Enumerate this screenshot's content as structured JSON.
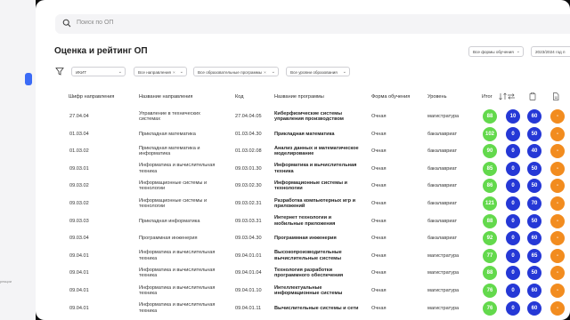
{
  "search": {
    "placeholder": "Поиск по ОП"
  },
  "page": {
    "title": "Оценка и рейтинг ОП"
  },
  "top_filters": {
    "forms": "Все формы обучения",
    "year": "2023/2024 год п"
  },
  "filters": {
    "institute": "ИКИТ",
    "directions": "Все направления",
    "programs": "Все образовательные программы",
    "levels": "Все уровни образования"
  },
  "sidebar": {
    "footer_text": "рекции"
  },
  "columns": {
    "code_dir": "Шифр направления",
    "name_dir": "Название направления",
    "code": "Код",
    "program": "Название программы",
    "form": "Форма обучения",
    "level": "Уровень",
    "total": "Итог"
  },
  "colors": {
    "green": "#63d94c",
    "blue": "#2538d6",
    "orange": "#f28c1f",
    "accent": "#3b6bf6"
  },
  "rows": [
    {
      "code_dir": "27.04.04",
      "name_dir": [
        "Управление в технических",
        "системах"
      ],
      "code": "27.04.04.05",
      "program": [
        "Киберфизические системы",
        "управления производством"
      ],
      "form": "Очная",
      "level": "магистратура",
      "total": "88",
      "s1": "10",
      "s2": "60",
      "s3": "-"
    },
    {
      "code_dir": "01.03.04",
      "name_dir": [
        "Прикладная математика"
      ],
      "code": "01.03.04.30",
      "program": [
        "Прикладная математика"
      ],
      "form": "Очная",
      "level": "бакалавриат",
      "total": "102",
      "s1": "0",
      "s2": "50",
      "s3": "-"
    },
    {
      "code_dir": "01.03.02",
      "name_dir": [
        "Прикладная математика и",
        "информатика"
      ],
      "code": "01.03.02.08",
      "program": [
        "Анализ данных и математическое",
        "моделирование"
      ],
      "form": "Очная",
      "level": "бакалавриат",
      "total": "90",
      "s1": "0",
      "s2": "40",
      "s3": "-"
    },
    {
      "code_dir": "09.03.01",
      "name_dir": [
        "Информатика и вычислительная",
        "техника"
      ],
      "code": "09.03.01.30",
      "program": [
        "Информатика и вычислительная",
        "техника"
      ],
      "form": "Очная",
      "level": "бакалавриат",
      "total": "85",
      "s1": "0",
      "s2": "50",
      "s3": "-"
    },
    {
      "code_dir": "09.03.02",
      "name_dir": [
        "Информационные системы и",
        "технологии"
      ],
      "code": "09.03.02.30",
      "program": [
        "Информационные системы и",
        "технологии"
      ],
      "form": "Очная",
      "level": "бакалавриат",
      "total": "86",
      "s1": "0",
      "s2": "50",
      "s3": "-"
    },
    {
      "code_dir": "09.03.02",
      "name_dir": [
        "Информационные системы и",
        "технологии"
      ],
      "code": "09.03.02.31",
      "program": [
        "Разработка компьютерных игр и",
        "приложений"
      ],
      "form": "Очная",
      "level": "бакалавриат",
      "total": "121",
      "s1": "0",
      "s2": "70",
      "s3": "-"
    },
    {
      "code_dir": "09.03.03",
      "name_dir": [
        "Прикладная информатика"
      ],
      "code": "09.03.03.31",
      "program": [
        "Интернет технологии и",
        "мобильные приложения"
      ],
      "form": "Очная",
      "level": "бакалавриат",
      "total": "88",
      "s1": "0",
      "s2": "50",
      "s3": "-"
    },
    {
      "code_dir": "09.03.04",
      "name_dir": [
        "Программная инженерия"
      ],
      "code": "09.03.04.30",
      "program": [
        "Программная инженерия"
      ],
      "form": "Очная",
      "level": "бакалавриат",
      "total": "92",
      "s1": "0",
      "s2": "60",
      "s3": "-"
    },
    {
      "code_dir": "09.04.01",
      "name_dir": [
        "Информатика и вычислительная",
        "техника"
      ],
      "code": "09.04.01.01",
      "program": [
        "Высокопроизводительные",
        "вычислительные системы"
      ],
      "form": "Очная",
      "level": "магистратура",
      "total": "77",
      "s1": "0",
      "s2": "65",
      "s3": "-"
    },
    {
      "code_dir": "09.04.01",
      "name_dir": [
        "Информатика и вычислительная",
        "техника"
      ],
      "code": "09.04.01.04",
      "program": [
        "Технология разработки",
        "программного обеспечения"
      ],
      "form": "Очная",
      "level": "магистратура",
      "total": "88",
      "s1": "0",
      "s2": "50",
      "s3": "-"
    },
    {
      "code_dir": "09.04.01",
      "name_dir": [
        "Информатика и вычислительная",
        "техника"
      ],
      "code": "09.04.01.10",
      "program": [
        "Интеллектуальные",
        "информационные системы"
      ],
      "form": "Очная",
      "level": "магистратура",
      "total": "76",
      "s1": "0",
      "s2": "60",
      "s3": "-"
    },
    {
      "code_dir": "09.04.01",
      "name_dir": [
        "Информатика и вычислительная",
        "техника"
      ],
      "code": "09.04.01.11",
      "program": [
        "Вычислительные системы и сети"
      ],
      "form": "Очная",
      "level": "магистратура",
      "total": "76",
      "s1": "0",
      "s2": "60",
      "s3": "-"
    }
  ]
}
